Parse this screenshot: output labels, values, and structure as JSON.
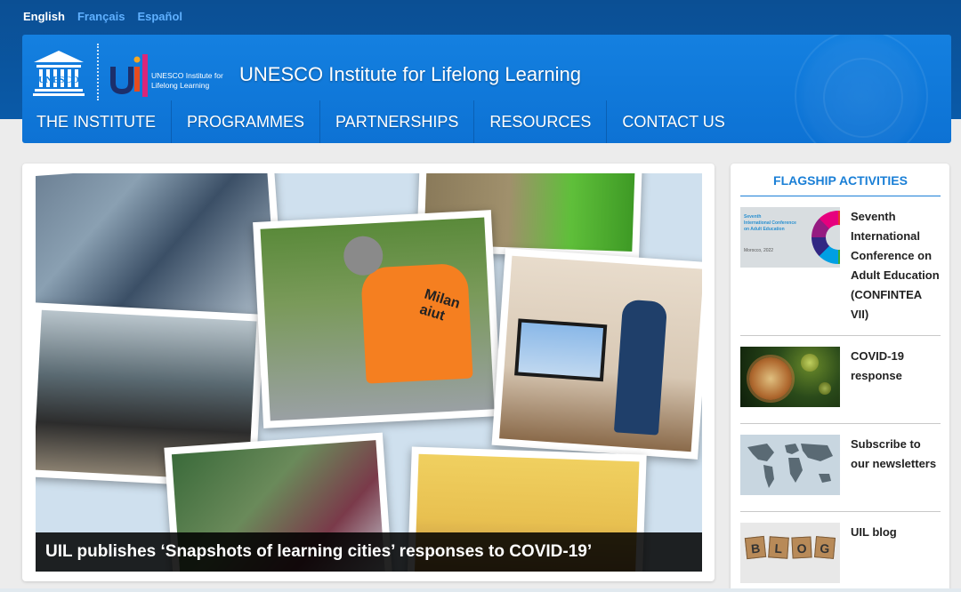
{
  "languages": [
    {
      "label": "English",
      "active": true
    },
    {
      "label": "Français",
      "active": false
    },
    {
      "label": "Español",
      "active": false
    }
  ],
  "header": {
    "logo_unesco": "UNESCO",
    "logo_uil_sub": "UNESCO Institute for Lifelong Learning",
    "title": "UNESCO Institute for Lifelong Learning"
  },
  "nav": [
    {
      "label": "THE INSTITUTE"
    },
    {
      "label": "PROGRAMMES"
    },
    {
      "label": "PARTNERSHIPS"
    },
    {
      "label": "RESOURCES"
    },
    {
      "label": "CONTACT US"
    }
  ],
  "hero": {
    "caption": "UIL publishes ‘Snapshots of learning cities’ responses to COVID-19’",
    "vest_text": "Milan aiut"
  },
  "sidebar": {
    "title": "FLAGSHIP ACTIVITIES",
    "items": [
      {
        "label": "Seventh International Conference on Adult Education (CONFINTEA VII)",
        "thumb_text": [
          "Seventh",
          "International Conference",
          "on Adult Education",
          "Morocco, 2022"
        ]
      },
      {
        "label": "COVID-19 response"
      },
      {
        "label": "Subscribe to our newsletters"
      },
      {
        "label": "UIL blog",
        "thumb_text": "BLOG"
      }
    ]
  },
  "colors": {
    "header_blue": "#1480e0",
    "top_band": "#0b4f94",
    "accent": "#1a7fd6",
    "vest_orange": "#f57f20"
  }
}
